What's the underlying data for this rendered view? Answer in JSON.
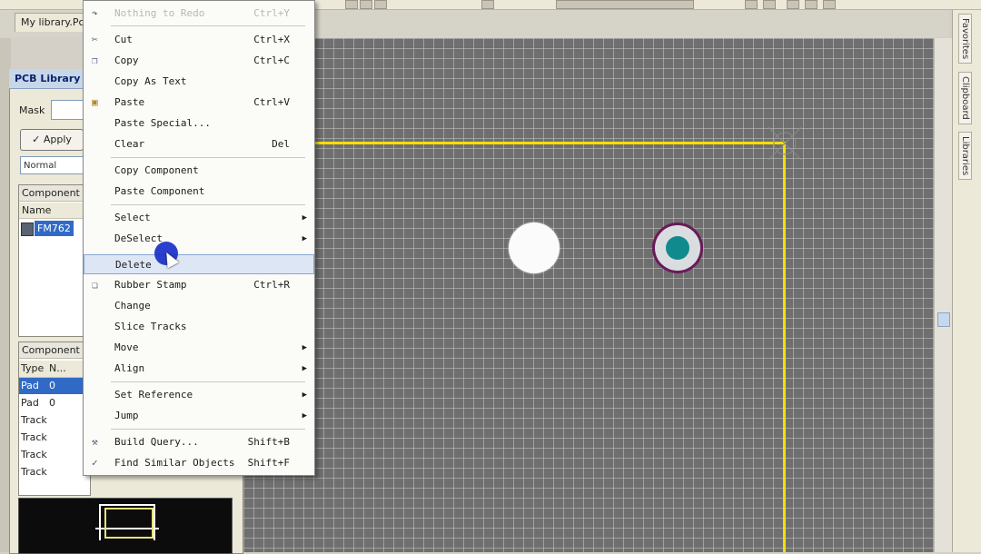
{
  "document": {
    "tab_title": "My library.PcbLib"
  },
  "right_dock": {
    "tabs": [
      "Favorites",
      "Clipboard",
      "Libraries"
    ]
  },
  "pcb_library_panel": {
    "title": "PCB Library",
    "mask_label": "Mask",
    "mask_value": "",
    "apply_label": "Apply",
    "filter_mode": "Normal",
    "components_header": "Component",
    "components_column": "Name",
    "components": [
      {
        "name": "FM762",
        "selected": true
      }
    ],
    "primitives_header": "Component",
    "primitives_columns": [
      "Type",
      "N..."
    ],
    "primitives": [
      {
        "type": "Pad",
        "name": "0",
        "selected": true
      },
      {
        "type": "Pad",
        "name": "0",
        "selected": false
      },
      {
        "type": "Track",
        "name": "",
        "selected": false
      },
      {
        "type": "Track",
        "name": "",
        "selected": false
      },
      {
        "type": "Track",
        "name": "",
        "selected": false
      },
      {
        "type": "Track",
        "name": "",
        "selected": false
      }
    ]
  },
  "context_menu": {
    "items": [
      {
        "label": "Nothing to Redo",
        "shortcut": "Ctrl+Y",
        "disabled": true,
        "icon": "redo-icon"
      },
      {
        "label": "Cut",
        "shortcut": "Ctrl+X",
        "icon": "scissors-icon"
      },
      {
        "label": "Copy",
        "shortcut": "Ctrl+C",
        "icon": "copy-icon"
      },
      {
        "label": "Copy As Text",
        "shortcut": ""
      },
      {
        "label": "Paste",
        "shortcut": "Ctrl+V",
        "icon": "paste-icon"
      },
      {
        "label": "Paste Special...",
        "shortcut": ""
      },
      {
        "label": "Clear",
        "shortcut": "Del"
      },
      {
        "label": "Copy Component",
        "shortcut": ""
      },
      {
        "label": "Paste Component",
        "shortcut": ""
      },
      {
        "label": "Select",
        "submenu": true
      },
      {
        "label": "DeSelect",
        "submenu": true
      },
      {
        "label": "Delete",
        "shortcut": "",
        "highlighted": true
      },
      {
        "label": "Rubber Stamp",
        "shortcut": "Ctrl+R",
        "icon": "stamp-icon"
      },
      {
        "label": "Change",
        "shortcut": ""
      },
      {
        "label": "Slice Tracks",
        "shortcut": ""
      },
      {
        "label": "Move",
        "submenu": true
      },
      {
        "label": "Align",
        "submenu": true
      },
      {
        "label": "Set Reference",
        "submenu": true
      },
      {
        "label": "Jump",
        "submenu": true
      },
      {
        "label": "Build Query...",
        "shortcut": "Shift+B",
        "icon": "query-icon"
      },
      {
        "label": "Find Similar Objects",
        "shortcut": "Shift+F",
        "icon": "find-icon"
      }
    ]
  },
  "colors": {
    "board_outline": "#f4e000",
    "canvas_bg": "#6f6f6f",
    "pad_hole": "#118a8e",
    "selection_blue": "#316ac5"
  }
}
